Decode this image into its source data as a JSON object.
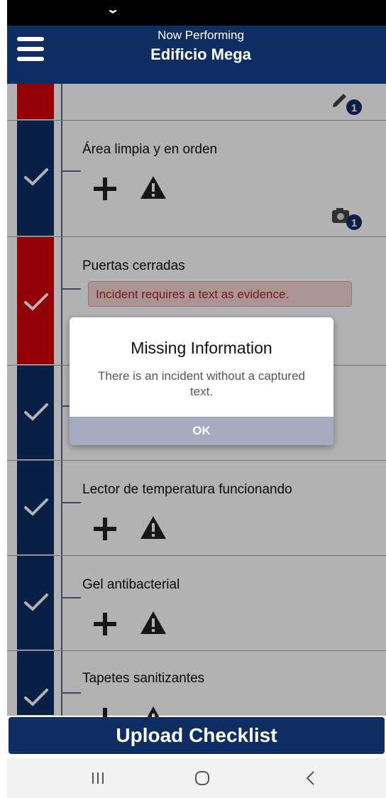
{
  "header": {
    "subtitle": "Now Performing",
    "title": "Edificio Mega"
  },
  "items": [
    {
      "label": "",
      "status": "incident",
      "badge_icon": "pencil-icon",
      "badge_count": "1"
    },
    {
      "label": "Área limpia y en orden",
      "status": "incident-ok",
      "badge_icon": "camera-icon",
      "badge_count": "1"
    },
    {
      "label": "Puertas cerradas",
      "status": "incident",
      "message": "Incident requires a text as evidence."
    },
    {
      "label": "",
      "status": "ok"
    },
    {
      "label": "Lector de temperatura funcionando",
      "status": "ok"
    },
    {
      "label": "Gel antibacterial",
      "status": "ok"
    },
    {
      "label": "Tapetes sanitizantes",
      "status": "ok"
    }
  ],
  "dialog": {
    "title": "Missing Information",
    "message": "There is an incident without a captured text.",
    "ok_label": "OK"
  },
  "upload": {
    "label": "Upload Checklist"
  },
  "colors": {
    "primary": "#0d2d63",
    "incident": "#d4000a",
    "dialog_button": "#a4abbe"
  }
}
